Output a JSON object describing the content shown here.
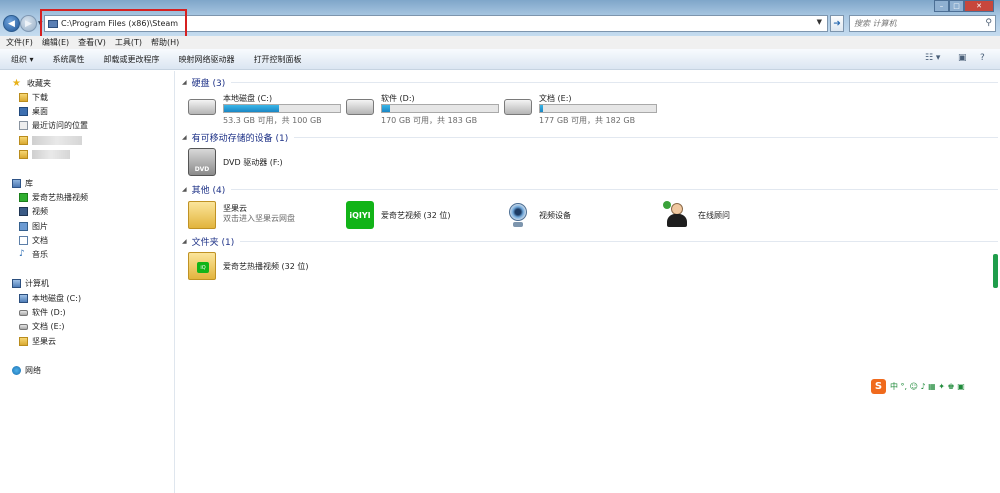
{
  "address": {
    "path": "C:\\Program Files (x86)\\Steam"
  },
  "search": {
    "placeholder": "搜索 计算机"
  },
  "menu": [
    "文件(F)",
    "编辑(E)",
    "查看(V)",
    "工具(T)",
    "帮助(H)"
  ],
  "toolbar": {
    "organize": "组织 ▾",
    "sys_props": "系统属性",
    "uninstall": "卸载或更改程序",
    "map_drive": "映射网络驱动器",
    "control_panel": "打开控制面板"
  },
  "sidebar": {
    "favorites": "收藏夹",
    "downloads": "下载",
    "desktop": "桌面",
    "recent": "最近访问的位置",
    "libraries": "库",
    "lib_iqiyi": "爱奇艺热播视频",
    "lib_video": "视频",
    "lib_pictures": "图片",
    "lib_docs": "文档",
    "lib_music": "音乐",
    "computer": "计算机",
    "drive_c": "本地磁盘 (C:)",
    "drive_d": "软件 (D:)",
    "drive_e": "文档 (E:)",
    "jianguoyun": "坚果云",
    "network": "网络"
  },
  "groups": {
    "hdd": "硬盘 (3)",
    "removable": "有可移动存储的设备 (1)",
    "other": "其他 (4)",
    "folders": "文件夹 (1)"
  },
  "drives": [
    {
      "name": "本地磁盘 (C:)",
      "free": "53.3 GB 可用，共 100 GB",
      "used_fraction": 0.47
    },
    {
      "name": "软件 (D:)",
      "free": "170 GB 可用，共 183 GB",
      "used_fraction": 0.07
    },
    {
      "name": "文档 (E:)",
      "free": "177 GB 可用，共 182 GB",
      "used_fraction": 0.03
    }
  ],
  "removable": {
    "dvd_label": "DVD",
    "name": "DVD 驱动器 (F:)"
  },
  "other": {
    "jianguoyun_name": "坚果云",
    "jianguoyun_sub": "双击进入坚果云网盘",
    "iqiyi_logo": "iQIYI",
    "iqiyi_name": "爱奇艺视频 (32 位)",
    "camera_name": "视频设备",
    "support_name": "在线顾问"
  },
  "folders": {
    "iqiyi_folder": "爱奇艺热播视频 (32 位)"
  },
  "ime": {
    "logo": "S",
    "symbols": "中 °, ☺ ♪ ▦ ✦ ♚ ▣"
  },
  "colors": {
    "group_header": "#1e3287",
    "drive_bar": "#1a86c4",
    "highlight": "#d62020"
  }
}
